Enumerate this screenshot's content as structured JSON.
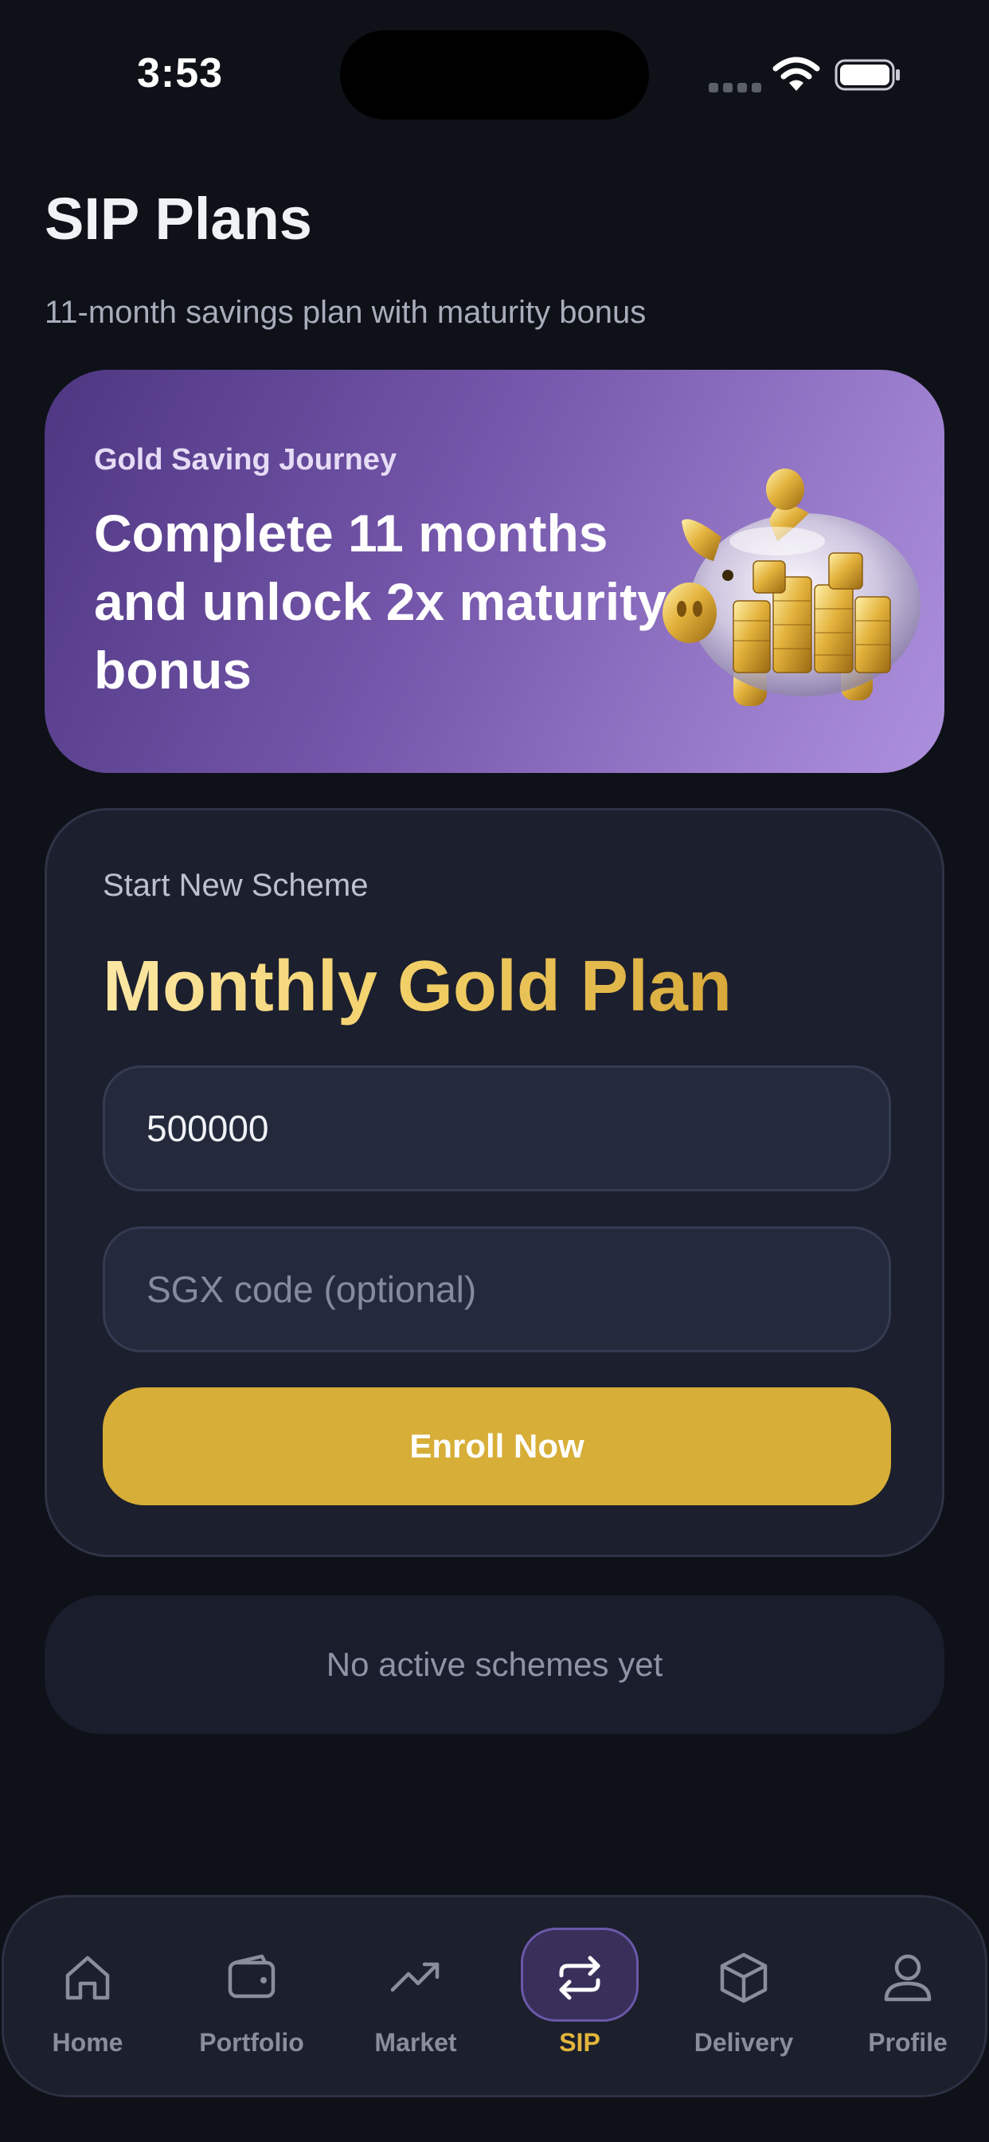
{
  "status_bar": {
    "time": "3:53",
    "icons": [
      "signal-dots-icon",
      "wifi-icon",
      "battery-icon"
    ]
  },
  "header": {
    "title": "SIP Plans",
    "subtitle": "11-month savings plan with maturity bonus"
  },
  "banner": {
    "eyebrow": "Gold Saving Journey",
    "headline": "Complete 11 months and unlock 2x maturity bonus",
    "image": "gold-piggy-bank-illustration"
  },
  "scheme_card": {
    "eyebrow": "Start New Scheme",
    "title": "Monthly Gold Plan",
    "amount_value": "500000",
    "code_placeholder": "SGX code (optional)",
    "enroll_label": "Enroll Now"
  },
  "empty_state": {
    "text": "No active schemes yet"
  },
  "bottom_nav": {
    "items": [
      {
        "label": "Home",
        "icon": "home-icon",
        "active": false
      },
      {
        "label": "Portfolio",
        "icon": "wallet-icon",
        "active": false
      },
      {
        "label": "Market",
        "icon": "trending-up-icon",
        "active": false
      },
      {
        "label": "SIP",
        "icon": "repeat-icon",
        "active": true
      },
      {
        "label": "Delivery",
        "icon": "box-icon",
        "active": false
      },
      {
        "label": "Profile",
        "icon": "user-icon",
        "active": false
      }
    ]
  },
  "colors": {
    "background": "#0e1118",
    "accent_gold": "#d7ae37",
    "banner_purple": "#7557ab",
    "active_nav": "#e2b63c"
  }
}
